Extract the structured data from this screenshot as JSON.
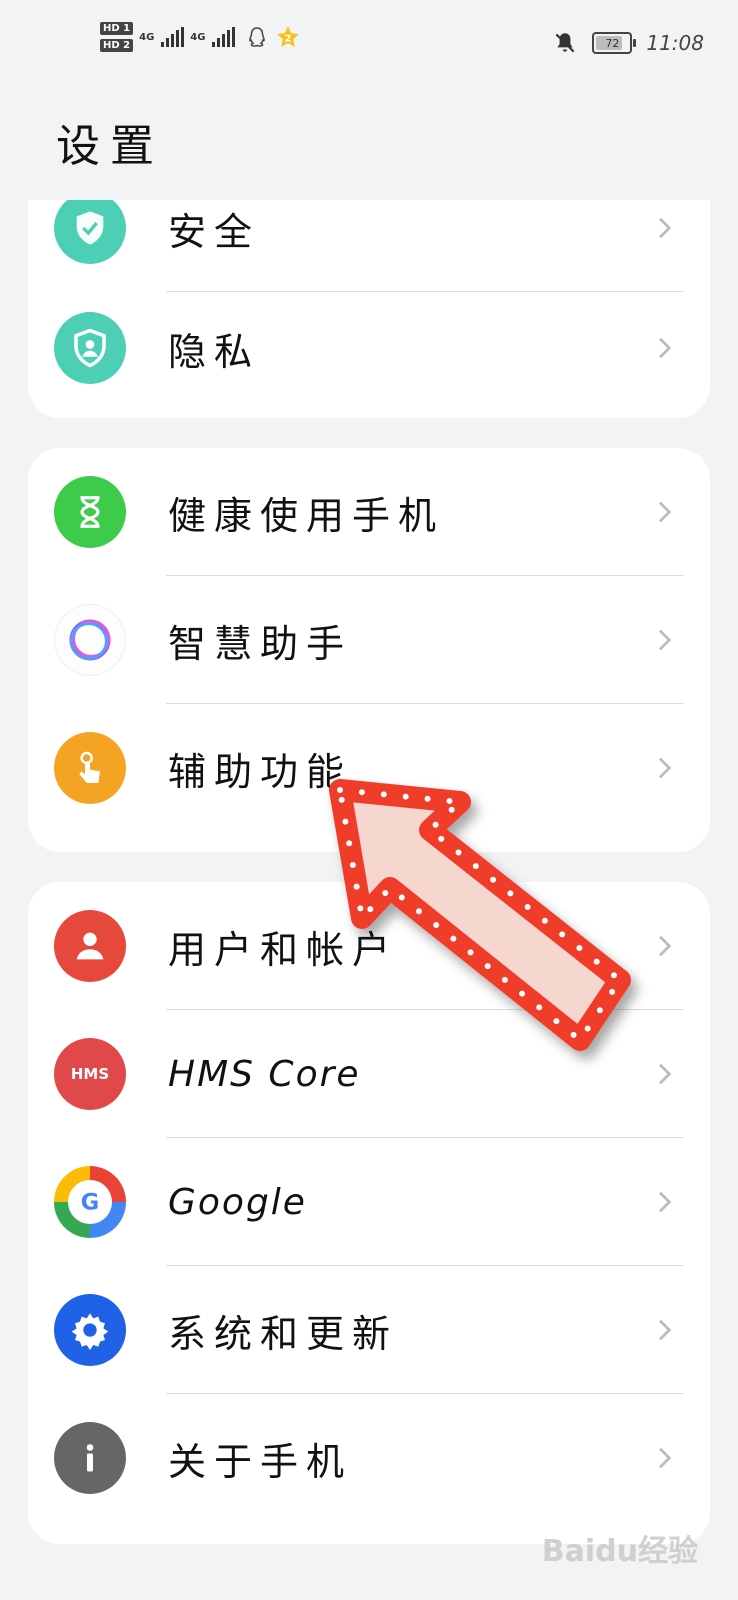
{
  "status_bar": {
    "hd1": "HD 1",
    "hd2": "HD 2",
    "net1": "4G",
    "net2": "4G",
    "battery": "72",
    "time": "11:08"
  },
  "page": {
    "title": "设置"
  },
  "card1": {
    "items": [
      {
        "label": "安全",
        "icon": "shield-check-icon",
        "color": "#4ccfb4"
      },
      {
        "label": "隐私",
        "icon": "privacy-shield-icon",
        "color": "#4ccfb4"
      }
    ]
  },
  "card2": {
    "items": [
      {
        "label": "健康使用手机",
        "icon": "hourglass-icon",
        "color": "#3ccb4a"
      },
      {
        "label": "智慧助手",
        "icon": "assistant-ring-icon",
        "color": "#ffffff"
      },
      {
        "label": "辅助功能",
        "icon": "hand-touch-icon",
        "color": "#f5a323"
      }
    ]
  },
  "card3": {
    "items": [
      {
        "label": "用户和帐户",
        "icon": "user-icon",
        "color": "#e6483b"
      },
      {
        "label": "HMS Core",
        "icon": "hms-icon",
        "color": "#e0484a"
      },
      {
        "label": "Google",
        "icon": "google-icon",
        "color": "#4285f4"
      },
      {
        "label": "系统和更新",
        "icon": "gear-icon",
        "color": "#1f62e8"
      },
      {
        "label": "关于手机",
        "icon": "info-icon",
        "color": "#666666"
      }
    ]
  },
  "watermark": "Baidu经验",
  "accent_arrow_color": "#f03c2c"
}
